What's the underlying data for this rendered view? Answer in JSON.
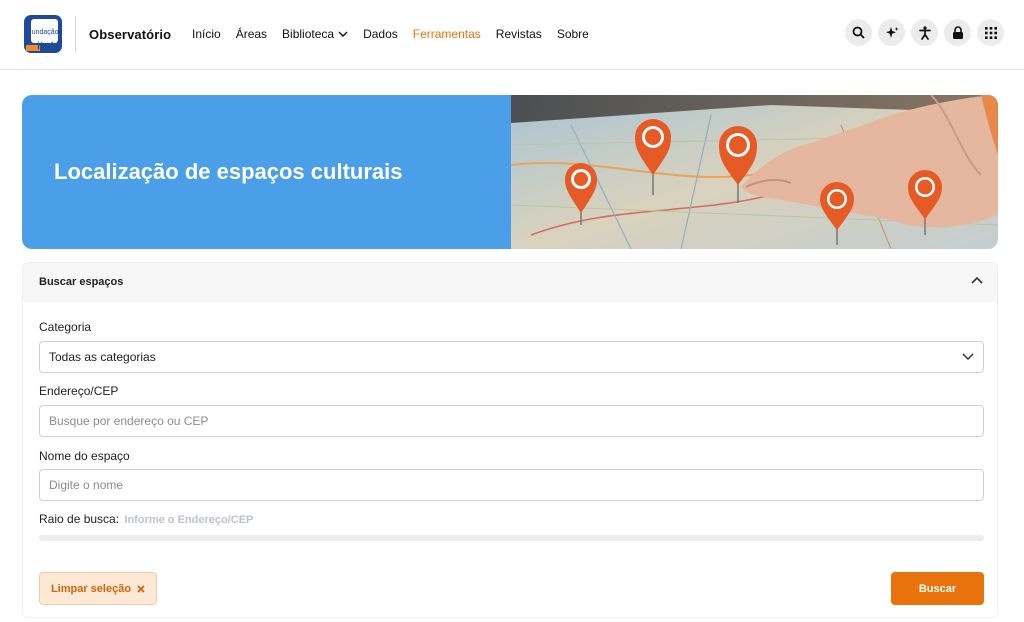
{
  "header": {
    "logo_text_top": "Fundação",
    "logo_text_bottom": "itaú",
    "brand": "Observatório",
    "nav": [
      {
        "label": "Início"
      },
      {
        "label": "Áreas"
      },
      {
        "label": "Biblioteca"
      },
      {
        "label": "Dados"
      },
      {
        "label": "Ferramentas"
      },
      {
        "label": "Revistas"
      },
      {
        "label": "Sobre"
      }
    ],
    "active_nav": "Ferramentas",
    "tools": [
      "search-icon",
      "sparkle-icon",
      "accessibility-icon",
      "lock-icon",
      "apps-grid-icon"
    ]
  },
  "banner": {
    "title": "Localização de espaços culturais"
  },
  "search": {
    "header": "Buscar espaços",
    "category_label": "Categoria",
    "category_value": "Todas as categorias",
    "address_label": "Endereço/CEP",
    "address_placeholder": "Busque por endereço ou CEP",
    "name_label": "Nome do espaço",
    "name_placeholder": "Digite o nome",
    "radius_label": "Raio de busca:",
    "radius_hint": "Informe o Endereço/CEP",
    "clear_label": "Limpar seleção",
    "submit_label": "Buscar"
  },
  "colors": {
    "accent": "#e8730c",
    "banner_blue": "#4a9fe8",
    "logo_blue": "#1e4a9a"
  }
}
